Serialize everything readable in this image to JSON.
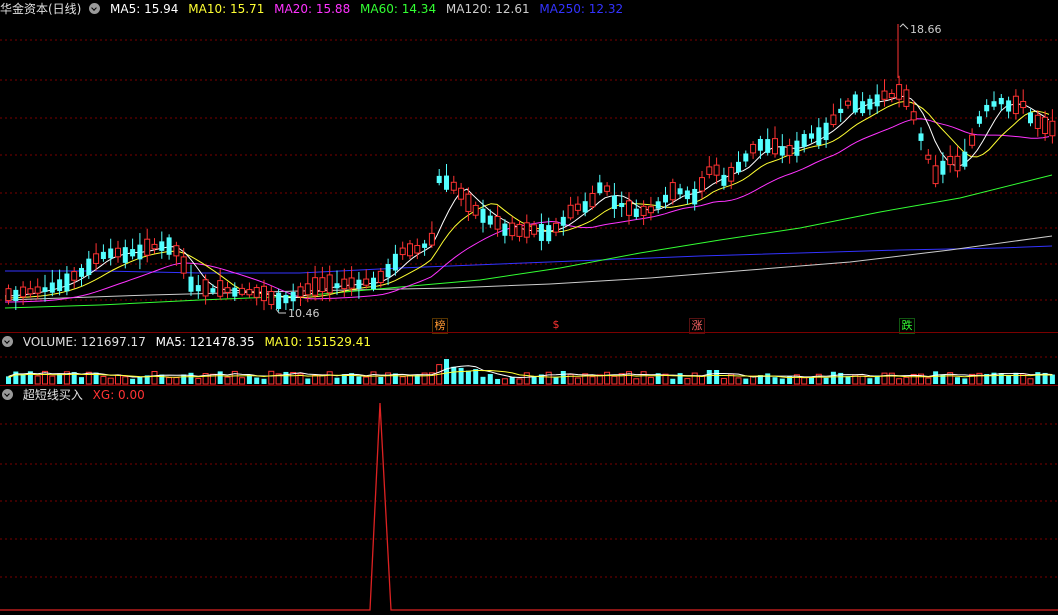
{
  "main": {
    "title": "华金资本(日线)",
    "ma": [
      {
        "label": "MA5: 15.94",
        "color": "#ffffff"
      },
      {
        "label": "MA10: 15.71",
        "color": "#ffff33"
      },
      {
        "label": "MA20: 15.88",
        "color": "#ff33ff"
      },
      {
        "label": "MA60: 14.34",
        "color": "#33ff33"
      },
      {
        "label": "MA120: 12.61",
        "color": "#cccccc"
      },
      {
        "label": "MA250: 12.32",
        "color": "#3333ff"
      }
    ],
    "high_label": "18.66",
    "low_label": "10.46",
    "signals": [
      {
        "text": "榜",
        "color": "#ff9933"
      },
      {
        "text": "$",
        "color": "#ff3333"
      },
      {
        "text": "涨",
        "color": "#ff6666"
      },
      {
        "text": "跌",
        "color": "#33ff33"
      }
    ]
  },
  "volume": {
    "label": "VOLUME: 121697.17",
    "ma5": "MA5: 121478.35",
    "ma10": "MA10: 151529.41"
  },
  "indicator": {
    "name": "超短线买入",
    "xg": "XG: 0.00"
  },
  "colors": {
    "up": "#ff3333",
    "down": "#54ffff",
    "grid": "#7a0000"
  }
}
